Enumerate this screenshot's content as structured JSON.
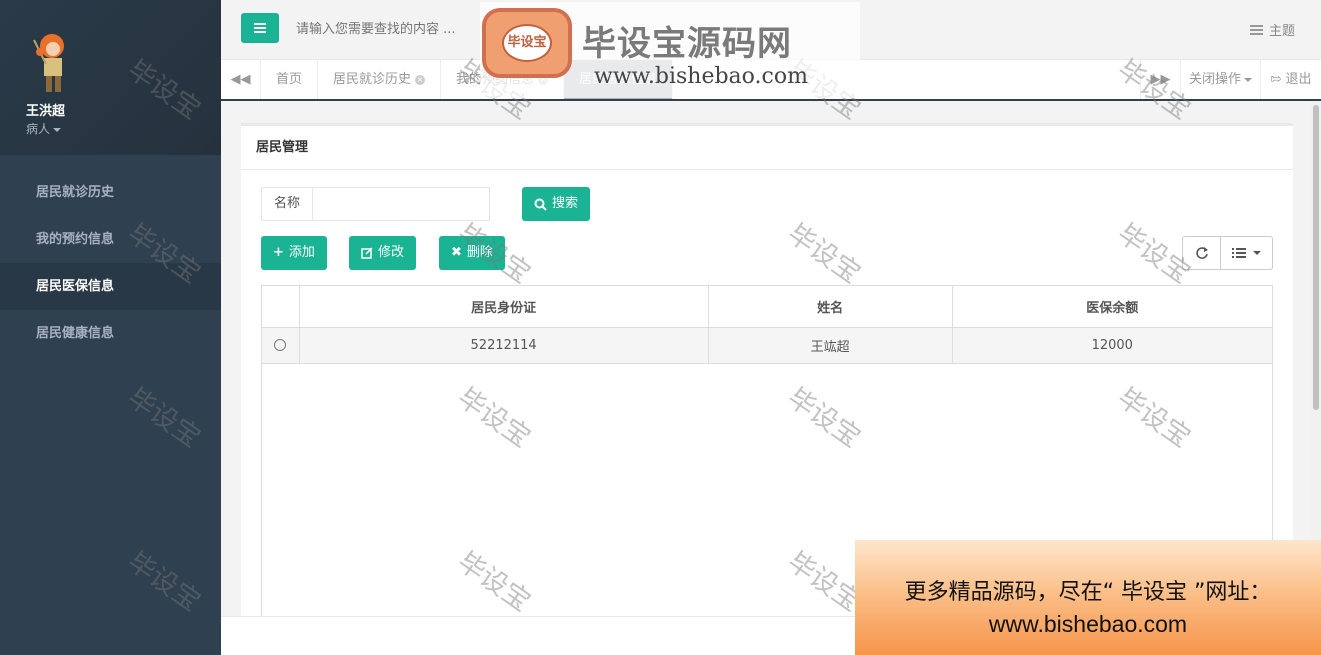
{
  "sidebar": {
    "user_name": "王洪超",
    "user_role": "病人",
    "items": [
      {
        "label": "居民就诊历史",
        "active": false
      },
      {
        "label": "我的预约信息",
        "active": false
      },
      {
        "label": "居民医保信息",
        "active": true
      },
      {
        "label": "居民健康信息",
        "active": false
      }
    ]
  },
  "topbar": {
    "search_placeholder": "请输入您需要查找的内容 ...",
    "theme_label": "主题"
  },
  "tabs": {
    "items": [
      {
        "label": "首页",
        "closable": false,
        "active": false
      },
      {
        "label": "居民就诊历史",
        "closable": true,
        "active": false
      },
      {
        "label": "我的预约信息",
        "closable": true,
        "active": false
      },
      {
        "label": "居民医保信息",
        "closable": false,
        "active": true
      }
    ],
    "close_ops_label": "关闭操作",
    "logout_label": "退出"
  },
  "panel": {
    "title": "居民管理",
    "filter_label": "名称",
    "filter_value": "",
    "search_button": "搜索",
    "add_button": "添加",
    "edit_button": "修改",
    "delete_button": "删除"
  },
  "table": {
    "columns": [
      "居民身份证",
      "姓名",
      "医保余额"
    ],
    "rows": [
      {
        "id_card": "52212114",
        "name": "王竑超",
        "balance": "12000"
      }
    ]
  },
  "watermarks": {
    "text": "毕设宝",
    "logo_badge": "毕设宝",
    "logo_title": "毕设宝源码网",
    "logo_url": "www.bishebao.com"
  },
  "promo": {
    "line1": "更多精品源码，尽在“ 毕设宝 ”网址：",
    "line2": "www.bishebao.com"
  },
  "colors": {
    "sidebar_bg": "#2f4050",
    "accent": "#1ab394"
  }
}
